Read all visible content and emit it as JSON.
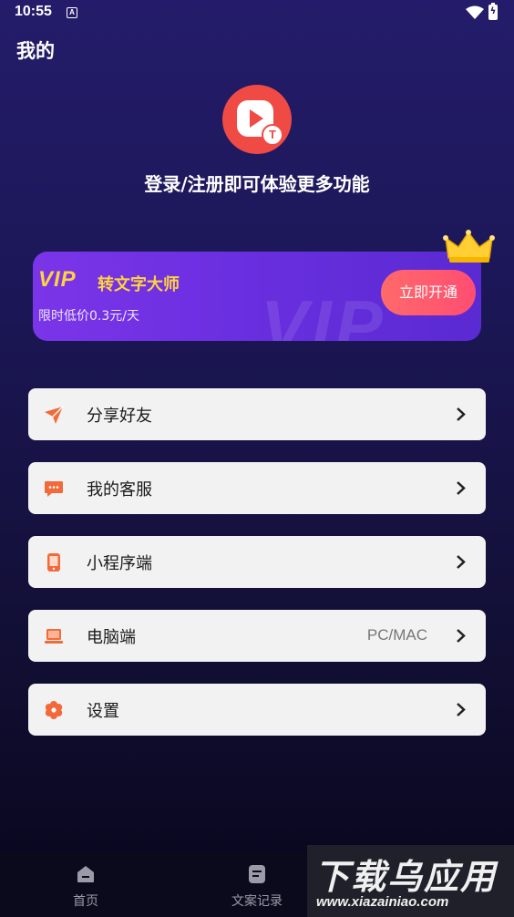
{
  "status_bar": {
    "time": "10:55",
    "notification_glyph": "A",
    "icons": [
      "wifi-icon",
      "battery-icon"
    ]
  },
  "header": {
    "title": "我的"
  },
  "profile": {
    "logo_icon": "play-t-logo-icon",
    "login_prompt": "登录/注册即可体验更多功能"
  },
  "vip": {
    "badge": "VIP",
    "title": "转文字大师",
    "subtitle": "限时低价0.3元/天",
    "button": "立即开通",
    "watermark": "VIP",
    "crown_icon": "crown-icon"
  },
  "menu": [
    {
      "label": "分享好友",
      "icon": "share-icon",
      "value": ""
    },
    {
      "label": "我的客服",
      "icon": "chat-icon",
      "value": ""
    },
    {
      "label": "小程序端",
      "icon": "phone-icon",
      "value": ""
    },
    {
      "label": "电脑端",
      "icon": "laptop-icon",
      "value": "PC/MAC"
    },
    {
      "label": "设置",
      "icon": "gear-icon",
      "value": ""
    }
  ],
  "tab_bar": {
    "home": "首页",
    "records": "文案记录"
  },
  "watermark": {
    "title": "下载乌应用",
    "url": "www.xiazainiao.com"
  },
  "colors": {
    "accent": "#f26a3a",
    "vip_gold": "#ffd23f",
    "vip_purple": "#6a2fe0",
    "button_pink": "#ff5a6e"
  }
}
